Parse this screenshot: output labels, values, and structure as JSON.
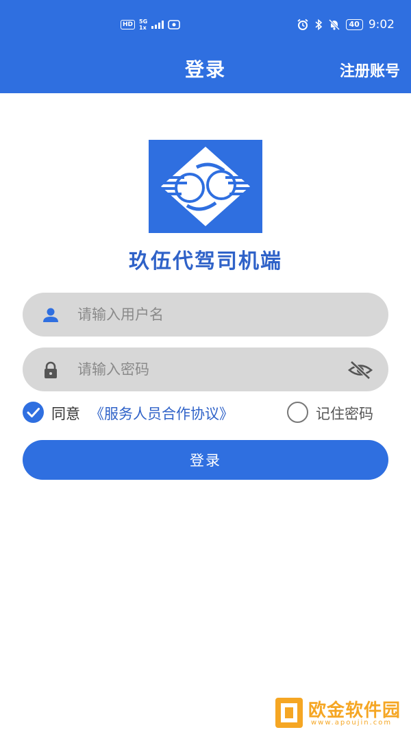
{
  "status_bar": {
    "hd": "HD",
    "network": "5G",
    "network_sub": "1x",
    "battery": "40",
    "time": "9:02"
  },
  "header": {
    "title": "登录",
    "register_label": "注册账号"
  },
  "app": {
    "name": "玖伍代驾司机端"
  },
  "form": {
    "username_placeholder": "请输入用户名",
    "password_placeholder": "请输入密码",
    "agree_label": "同意",
    "agreement_link": "《服务人员合作协议》",
    "agree_checked": true,
    "remember_label": "记住密码",
    "remember_checked": false,
    "login_label": "登录"
  },
  "watermark": {
    "text": "欧金软件园",
    "url": "www.apoujin.com"
  },
  "colors": {
    "primary": "#2f6fe0",
    "app_name": "#2f62c8",
    "field_bg": "#d7d7d7",
    "watermark": "#f5a623"
  }
}
